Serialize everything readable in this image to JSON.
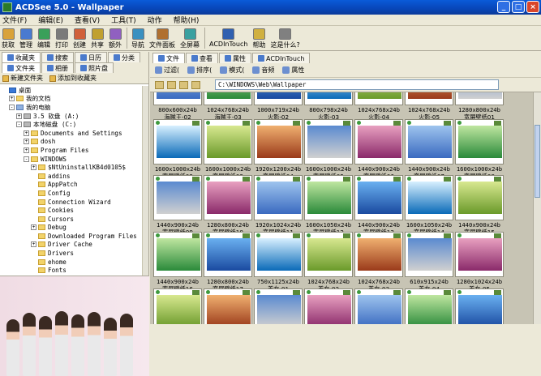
{
  "window": {
    "title": "ACDSee 5.0 - Wallpaper"
  },
  "menu": [
    "文件(F)",
    "编辑(E)",
    "查看(V)",
    "工具(T)",
    "动作",
    "帮助(H)"
  ],
  "toolbar": [
    {
      "label": "获取",
      "icon": "acquire-icon"
    },
    {
      "label": "管理",
      "icon": "manage-icon"
    },
    {
      "label": "编辑",
      "icon": "edit-icon"
    },
    {
      "label": "打印",
      "icon": "print-icon"
    },
    {
      "label": "创建",
      "icon": "create-icon"
    },
    {
      "label": "共享",
      "icon": "share-icon"
    },
    {
      "label": "额外",
      "icon": "extra-icon"
    },
    {
      "label": "导航",
      "icon": "navigate-icon"
    },
    {
      "label": "文件面板",
      "icon": "file-panel-icon"
    },
    {
      "label": "全屏幕",
      "icon": "fullscreen-icon"
    },
    {
      "label": "ACDInTouch",
      "icon": "acdintouch-icon"
    },
    {
      "label": "帮助",
      "icon": "help-icon"
    },
    {
      "label": "这是什么?",
      "icon": "whats-this-icon"
    }
  ],
  "left_tabs": [
    {
      "label": "收藏夹"
    },
    {
      "label": "搜索"
    },
    {
      "label": "日历"
    },
    {
      "label": "分类"
    }
  ],
  "left_tabs2": [
    {
      "label": "文件夹"
    },
    {
      "label": "相册"
    },
    {
      "label": "照片盘"
    }
  ],
  "favorites": {
    "new": "新建文件夹",
    "add": "添加到收藏夹"
  },
  "tree": [
    {
      "label": "桌面",
      "level": 0,
      "kind": "desk",
      "pm": ""
    },
    {
      "label": "我的文档",
      "level": 1,
      "kind": "folder",
      "pm": "+"
    },
    {
      "label": "我的电脑",
      "level": 1,
      "kind": "pc",
      "pm": "-"
    },
    {
      "label": "3.5 软盘 (A:)",
      "level": 2,
      "kind": "drv",
      "pm": "+"
    },
    {
      "label": "本地磁盘 (C:)",
      "level": 2,
      "kind": "drv",
      "pm": "-"
    },
    {
      "label": "Documents and Settings",
      "level": 3,
      "kind": "folder",
      "pm": "+"
    },
    {
      "label": "dosh",
      "level": 3,
      "kind": "folder",
      "pm": "+"
    },
    {
      "label": "Program Files",
      "level": 3,
      "kind": "folder",
      "pm": "+"
    },
    {
      "label": "WINDOWS",
      "level": 3,
      "kind": "folder",
      "pm": "-"
    },
    {
      "label": "$NtUninstallKB4d0105$",
      "level": 4,
      "kind": "folder",
      "pm": "+"
    },
    {
      "label": "addins",
      "level": 4,
      "kind": "folder",
      "pm": ""
    },
    {
      "label": "AppPatch",
      "level": 4,
      "kind": "folder",
      "pm": ""
    },
    {
      "label": "Config",
      "level": 4,
      "kind": "folder",
      "pm": ""
    },
    {
      "label": "Connection Wizard",
      "level": 4,
      "kind": "folder",
      "pm": ""
    },
    {
      "label": "Cookies",
      "level": 4,
      "kind": "folder",
      "pm": ""
    },
    {
      "label": "Cursors",
      "level": 4,
      "kind": "folder",
      "pm": ""
    },
    {
      "label": "Debug",
      "level": 4,
      "kind": "folder",
      "pm": "+"
    },
    {
      "label": "Downloaded Program Files",
      "level": 4,
      "kind": "folder",
      "pm": ""
    },
    {
      "label": "Driver Cache",
      "level": 4,
      "kind": "folder",
      "pm": "+"
    },
    {
      "label": "Drivers",
      "level": 4,
      "kind": "folder",
      "pm": ""
    },
    {
      "label": "ehome",
      "level": 4,
      "kind": "folder",
      "pm": ""
    },
    {
      "label": "Fonts",
      "level": 4,
      "kind": "folder",
      "pm": ""
    }
  ],
  "right_tabs": [
    {
      "label": "文件"
    },
    {
      "label": "查看"
    },
    {
      "label": "属性"
    },
    {
      "label": "ACDInTouch"
    }
  ],
  "r_toolbar": [
    "过滤(",
    "排序(",
    "模式(",
    "音频",
    "属性"
  ],
  "address": "C:\\WINDOWS\\Web\\Wallpaper",
  "rows": [
    [
      {
        "dims": "800x600x24b",
        "name": "海贼王-02"
      },
      {
        "dims": "1024x768x24b",
        "name": "海贼王-03"
      },
      {
        "dims": "1000x719x24b",
        "name": "火影-02"
      },
      {
        "dims": "800x798x24b",
        "name": "火影-03"
      },
      {
        "dims": "1024x768x24b",
        "name": "火影-04"
      },
      {
        "dims": "1024x768x24b",
        "name": "火影-05"
      },
      {
        "dims": "1280x800x24b",
        "name": "宽屏壁纸01"
      }
    ],
    [
      {
        "dims": "1600x1000x24b",
        "name": "宽屏壁纸02"
      },
      {
        "dims": "1600x1000x24b",
        "name": "宽屏壁纸03"
      },
      {
        "dims": "1920x1200x24b",
        "name": "宽屏壁纸04"
      },
      {
        "dims": "1600x1000x24b",
        "name": "宽屏壁纸05"
      },
      {
        "dims": "1440x900x24b",
        "name": "宽屏壁纸06"
      },
      {
        "dims": "1440x900x24b",
        "name": "宽屏壁纸07"
      },
      {
        "dims": "1600x1000x24b",
        "name": "宽屏壁纸08"
      }
    ],
    [
      {
        "dims": "1440x900x24b",
        "name": "宽屏壁纸09"
      },
      {
        "dims": "1280x800x24b",
        "name": "宽屏壁纸10"
      },
      {
        "dims": "1920x1024x24b",
        "name": "宽屏壁纸11"
      },
      {
        "dims": "1600x1050x24b",
        "name": "宽屏壁纸12"
      },
      {
        "dims": "1440x900x24b",
        "name": "宽屏壁纸13"
      },
      {
        "dims": "1600x1050x24b",
        "name": "宽屏壁纸14"
      },
      {
        "dims": "1440x900x24b",
        "name": "宽屏壁纸15"
      }
    ],
    [
      {
        "dims": "1440x900x24b",
        "name": "宽屏壁纸16"
      },
      {
        "dims": "1280x800x24b",
        "name": "宽屏壁纸17"
      },
      {
        "dims": "750x1125x24b",
        "name": "美女-01"
      },
      {
        "dims": "1024x768x24b",
        "name": "美女-02"
      },
      {
        "dims": "1024x768x24b",
        "name": "美女-03"
      },
      {
        "dims": "610x915x24b",
        "name": "美女-04"
      },
      {
        "dims": "1280x1024x24b",
        "name": "美女-05"
      }
    ],
    [
      {
        "dims": "",
        "name": ""
      },
      {
        "dims": "",
        "name": ""
      },
      {
        "dims": "",
        "name": ""
      },
      {
        "dims": "",
        "name": ""
      },
      {
        "dims": "",
        "name": ""
      },
      {
        "dims": "",
        "name": ""
      },
      {
        "dims": "",
        "name": ""
      }
    ]
  ],
  "colors": {
    "accent": "#0a5bd8",
    "panel": "#ece9d8",
    "grid_bg": "#c7c4b4"
  }
}
